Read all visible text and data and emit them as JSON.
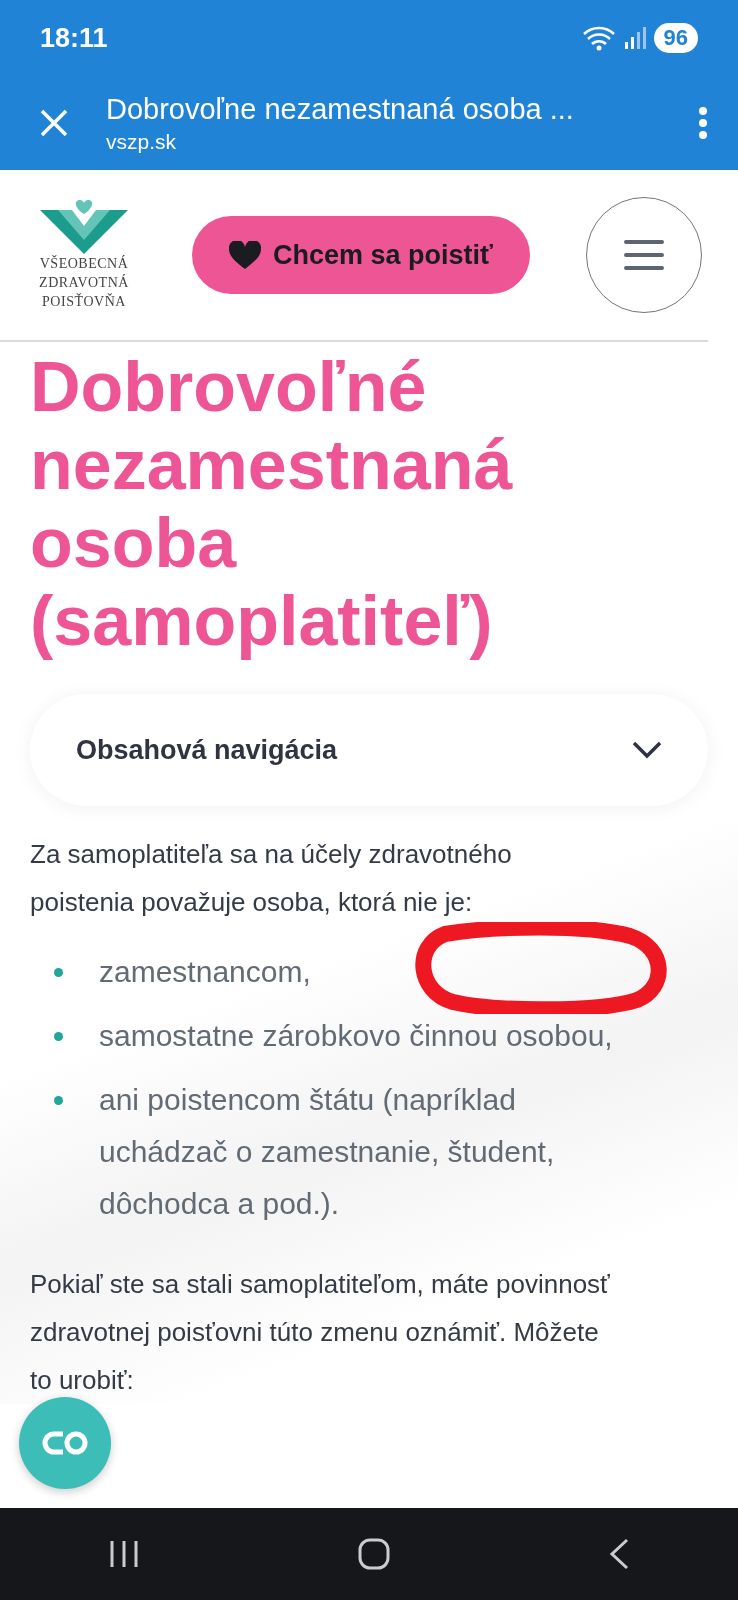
{
  "status_bar": {
    "time": "18:11",
    "battery": "96"
  },
  "browser": {
    "title": "Dobrovoľne nezamestnaná osoba ...",
    "url": "vszp.sk"
  },
  "site_header": {
    "logo_lines": [
      "VŠEOBECNÁ",
      "ZDRAVOTNÁ",
      "POISŤOVŇA"
    ],
    "cta": "Chcem sa poistiť"
  },
  "heading_lines": [
    "Dobrovoľné",
    "nezamestnaná",
    "osoba",
    "(samoplatiteľ)"
  ],
  "content_nav": {
    "label": "Obsahová navigácia",
    "expanded": false
  },
  "intro": "Za samoplatiteľa sa na účely zdravotného poistenia považuje osoba, ktorá nie je:",
  "bullets": [
    "zamestnancom,",
    "samostatne zárobkovo činnou osobou,",
    "ani poistencom štátu (napríklad uchádzač o zamestnanie, študent, dôchodca a pod.)."
  ],
  "paragraph": "Pokiaľ ste sa stali samoplatiteľom, máte povinnosť zdravotnej poisťovni túto zmenu oznámiť. Môžete to urobiť:"
}
